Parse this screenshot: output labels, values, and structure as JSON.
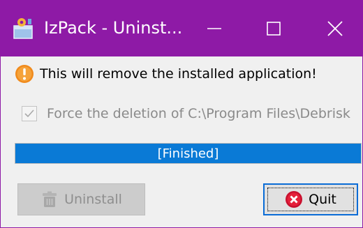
{
  "window": {
    "title": "IzPack - Uninst...",
    "controls": [
      "minimize",
      "maximize",
      "close"
    ],
    "accent_color": "#8e1aa6"
  },
  "message": {
    "text": "This will remove the installed application!",
    "icon": "warning-icon"
  },
  "force_delete": {
    "label": "Force the deletion of C:\\Program Files\\Debrisk",
    "checked": true,
    "enabled": false
  },
  "progress": {
    "text": "[Finished]",
    "value_percent": 100,
    "fill_color": "#0a7ad6"
  },
  "buttons": {
    "uninstall": {
      "label": "Uninstall",
      "enabled": false,
      "icon": "trash-icon"
    },
    "quit": {
      "label": "Quit",
      "enabled": true,
      "focused": true,
      "icon": "cancel-icon"
    }
  }
}
